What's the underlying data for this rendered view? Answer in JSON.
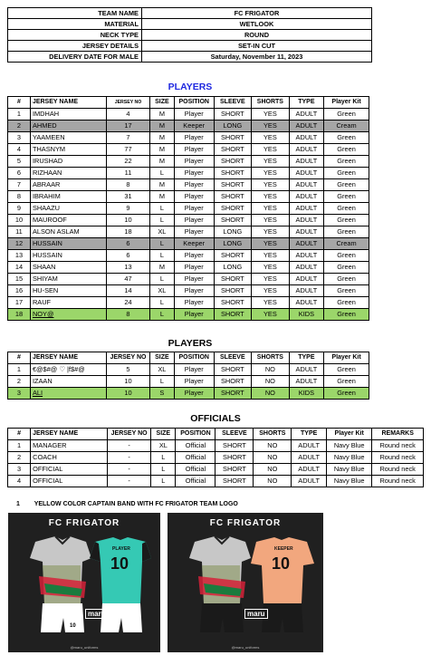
{
  "info": [
    {
      "label": "TEAM NAME",
      "value": "FC FRIGATOR"
    },
    {
      "label": "MATERIAL",
      "value": "WETLOOK"
    },
    {
      "label": "NECK TYPE",
      "value": "ROUND"
    },
    {
      "label": "JERSEY DETAILS",
      "value": "SET-IN CUT"
    },
    {
      "label": "DELIVERY DATE FOR MALE",
      "value": "Saturday, November 11, 2023"
    }
  ],
  "players1": {
    "title": "PLAYERS",
    "headers": [
      "#",
      "JERSEY NAME",
      "JERSEY NO",
      "SIZE",
      "POSITION",
      "SLEEVE",
      "SHORTS",
      "TYPE",
      "Player Kit"
    ],
    "rows": [
      [
        "1",
        "IMDHAH",
        "4",
        "M",
        "Player",
        "SHORT",
        "YES",
        "ADULT",
        "Green"
      ],
      [
        "2",
        "AHMED",
        "17",
        "M",
        "Keeper",
        "LONG",
        "YES",
        "ADULT",
        "Cream"
      ],
      [
        "3",
        "YAAMEEN",
        "7",
        "M",
        "Player",
        "SHORT",
        "YES",
        "ADULT",
        "Green"
      ],
      [
        "4",
        "THASNYM",
        "77",
        "M",
        "Player",
        "SHORT",
        "YES",
        "ADULT",
        "Green"
      ],
      [
        "5",
        "IRUSHAD",
        "22",
        "M",
        "Player",
        "SHORT",
        "YES",
        "ADULT",
        "Green"
      ],
      [
        "6",
        "RIZHAAN",
        "11",
        "L",
        "Player",
        "SHORT",
        "YES",
        "ADULT",
        "Green"
      ],
      [
        "7",
        "ABRAAR",
        "8",
        "M",
        "Player",
        "SHORT",
        "YES",
        "ADULT",
        "Green"
      ],
      [
        "8",
        "IBRAHIM",
        "31",
        "M",
        "Player",
        "SHORT",
        "YES",
        "ADULT",
        "Green"
      ],
      [
        "9",
        "SHAAZU",
        "9",
        "L",
        "Player",
        "SHORT",
        "YES",
        "ADULT",
        "Green"
      ],
      [
        "10",
        "MAUROOF",
        "10",
        "L",
        "Player",
        "SHORT",
        "YES",
        "ADULT",
        "Green"
      ],
      [
        "11",
        "ALSON ASLAM",
        "18",
        "XL",
        "Player",
        "LONG",
        "YES",
        "ADULT",
        "Green"
      ],
      [
        "12",
        "HUSSAIN",
        "6",
        "L",
        "Keeper",
        "LONG",
        "YES",
        "ADULT",
        "Cream"
      ],
      [
        "13",
        "HUSSAIN",
        "6",
        "L",
        "Player",
        "SHORT",
        "YES",
        "ADULT",
        "Green"
      ],
      [
        "14",
        "SHAAN",
        "13",
        "M",
        "Player",
        "LONG",
        "YES",
        "ADULT",
        "Green"
      ],
      [
        "15",
        "SHIYAM",
        "47",
        "L",
        "Player",
        "SHORT",
        "YES",
        "ADULT",
        "Green"
      ],
      [
        "16",
        "HU-SEN",
        "14",
        "XL",
        "Player",
        "SHORT",
        "YES",
        "ADULT",
        "Green"
      ],
      [
        "17",
        "RAUF",
        "24",
        "L",
        "Player",
        "SHORT",
        "YES",
        "ADULT",
        "Green"
      ],
      [
        "18",
        "NOY@",
        "8",
        "L",
        "Player",
        "SHORT",
        "YES",
        "KIDS",
        "Green"
      ]
    ],
    "gray_rows": [
      1,
      11
    ],
    "green_rows": [
      17
    ]
  },
  "players2": {
    "title": "PLAYERS",
    "headers": [
      "#",
      "JERSEY NAME",
      "JERSEY NO",
      "SIZE",
      "POSITION",
      "SLEEVE",
      "SHORTS",
      "TYPE",
      "Player Kit"
    ],
    "rows": [
      [
        "1",
        "€@$#@ ♡ |f$#@",
        "5",
        "XL",
        "Player",
        "SHORT",
        "NO",
        "ADULT",
        "Green"
      ],
      [
        "2",
        "IZAAN",
        "10",
        "L",
        "Player",
        "SHORT",
        "NO",
        "ADULT",
        "Green"
      ],
      [
        "3",
        "ALI",
        "10",
        "S",
        "Player",
        "SHORT",
        "NO",
        "KIDS",
        "Green"
      ]
    ],
    "green_rows": [
      2
    ]
  },
  "officials": {
    "title": "OFFICIALS",
    "headers": [
      "#",
      "JERSEY NAME",
      "JERSEY NO",
      "SIZE",
      "POSITION",
      "SLEEVE",
      "SHORTS",
      "TYPE",
      "Player Kit",
      "REMARKS"
    ],
    "rows": [
      [
        "1",
        "MANAGER",
        "-",
        "XL",
        "Official",
        "SHORT",
        "NO",
        "ADULT",
        "Navy Blue",
        "Round neck"
      ],
      [
        "2",
        "COACH",
        "-",
        "L",
        "Official",
        "SHORT",
        "NO",
        "ADULT",
        "Navy Blue",
        "Round neck"
      ],
      [
        "3",
        "OFFICIAL",
        "-",
        "L",
        "Official",
        "SHORT",
        "NO",
        "ADULT",
        "Navy Blue",
        "Round neck"
      ],
      [
        "4",
        "OFFICIAL",
        "-",
        "L",
        "Official",
        "SHORT",
        "NO",
        "ADULT",
        "Navy Blue",
        "Round neck"
      ]
    ]
  },
  "note": {
    "number": "1",
    "text": "YELLOW COLOR CAPTAIN BAND WITH FC FRIGATOR TEAM LOGO"
  },
  "mockups": [
    {
      "title": "FC FRIGATOR",
      "back_name": "PLAYER",
      "back_number": "10",
      "front_number": "10",
      "logo": "maru",
      "shirt_color": "#35c9b4",
      "short_color": "#ffffff",
      "footer": "@maru_uniforms"
    },
    {
      "title": "FC FRIGATOR",
      "back_name": "KEEPER",
      "back_number": "10",
      "front_number": "10",
      "logo": "maru",
      "shirt_color": "#f2a77e",
      "short_color": "#1a1a1a",
      "footer": "@maru_uniforms"
    }
  ]
}
